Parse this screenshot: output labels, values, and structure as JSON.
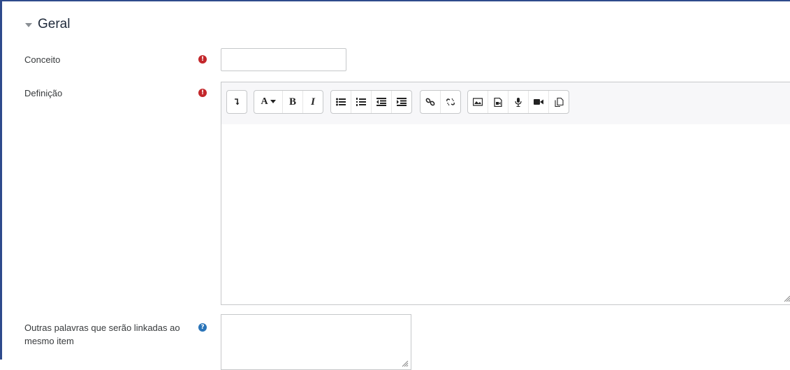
{
  "section": {
    "title": "Geral",
    "caret_icon": "caret-down-icon"
  },
  "fields": {
    "concept": {
      "label": "Conceito",
      "value": "",
      "required_icon": "exclamation-circle-icon"
    },
    "definition": {
      "label": "Definição",
      "content": "",
      "required_icon": "exclamation-circle-icon"
    },
    "keywords": {
      "label": "Outras palavras que serão linkadas ao mesmo item",
      "value": "",
      "help_icon": "question-circle-icon"
    }
  },
  "toolbar": {
    "groups": [
      [
        "collapse-toggle-icon"
      ],
      [
        "font-color-icon",
        "bold-icon",
        "italic-icon"
      ],
      [
        "unordered-list-icon",
        "ordered-list-icon",
        "outdent-icon",
        "indent-icon"
      ],
      [
        "link-icon",
        "unlink-icon"
      ],
      [
        "image-icon",
        "media-icon",
        "record-audio-icon",
        "record-video-icon",
        "manage-files-icon"
      ]
    ],
    "font_color_glyph": "A",
    "bold_glyph": "B",
    "italic_glyph": "I"
  },
  "colors": {
    "accent_frame": "#2e4a8c",
    "required": "#c3272b",
    "help": "#2a74b8"
  }
}
